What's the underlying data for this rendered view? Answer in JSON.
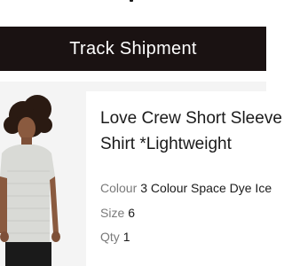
{
  "button": {
    "label": "Track Shipment"
  },
  "product": {
    "title_line1": "Love Crew Short Sleeve",
    "title_line2": "Shirt *Lightweight",
    "image_alt": "Model wearing a light grey short sleeve crew shirt",
    "attributes": [
      {
        "label": "Colour",
        "value": "3 Colour Space Dye Ice"
      },
      {
        "label": "Size",
        "value": "6"
      },
      {
        "label": "Qty",
        "value": "1"
      }
    ]
  },
  "colors": {
    "button_bg": "#1a1212",
    "panel_bg": "#f4f4f4",
    "shirt": "#d9dad6",
    "hair": "#2a1a12",
    "skin": "#8a5a3f"
  }
}
